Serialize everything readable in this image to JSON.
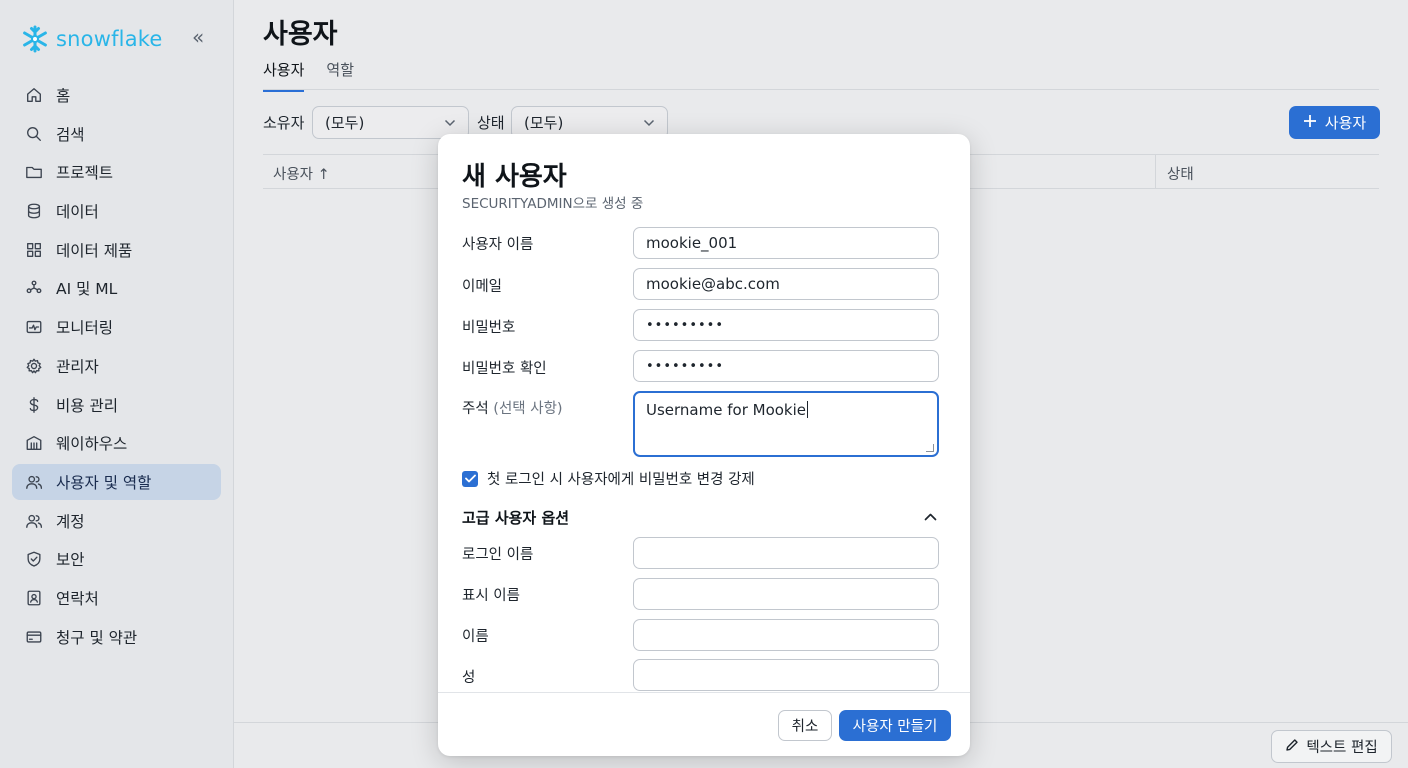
{
  "brand": {
    "name": "snowflake",
    "collapse_icon": "«"
  },
  "sidebar": {
    "items": [
      {
        "label": "홈",
        "icon": "home-icon"
      },
      {
        "label": "검색",
        "icon": "search-icon"
      },
      {
        "label": "프로젝트",
        "icon": "folder-icon"
      },
      {
        "label": "데이터",
        "icon": "database-icon"
      },
      {
        "label": "데이터 제품",
        "icon": "grid-icon"
      },
      {
        "label": "AI 및 ML",
        "icon": "ai-icon"
      },
      {
        "label": "모니터링",
        "icon": "monitor-icon"
      },
      {
        "label": "관리자",
        "icon": "gear-icon"
      },
      {
        "label": "비용 관리",
        "icon": "dollar-icon"
      },
      {
        "label": "웨이하우스",
        "icon": "warehouse-icon"
      },
      {
        "label": "사용자 및 역할",
        "icon": "users-icon",
        "active": true
      },
      {
        "label": "계정",
        "icon": "account-icon"
      },
      {
        "label": "보안",
        "icon": "shield-icon"
      },
      {
        "label": "연락처",
        "icon": "contact-icon"
      },
      {
        "label": "청구 및 약관",
        "icon": "card-icon"
      }
    ]
  },
  "main": {
    "title": "사용자",
    "tabs": [
      {
        "label": "사용자",
        "active": true
      },
      {
        "label": "역할"
      }
    ],
    "filters": {
      "owner_label": "소유자",
      "owner_value": "(모두)",
      "status_label": "상태",
      "status_value": "(모두)"
    },
    "add_button_label": "사용자",
    "table": {
      "col_user": "사용자 ↑",
      "col_status": "상태"
    },
    "edit_text_button": "텍스트 편집"
  },
  "modal": {
    "title": "새 사용자",
    "subtitle": "SECURITYADMIN으로 생성 중",
    "fields": {
      "username_label": "사용자 이름",
      "username_value": "mookie_001",
      "email_label": "이메일",
      "email_value": "mookie@abc.com",
      "password_label": "비밀번호",
      "password_value": "•••••••••",
      "confirm_label": "비밀번호 확인",
      "confirm_value": "•••••••••",
      "comment_label": "주석",
      "comment_optional": "(선택 사항)",
      "comment_value": "Username for Mookie"
    },
    "force_password_change": {
      "label": "첫 로그인 시 사용자에게 비밀번호 변경 강제",
      "checked": true
    },
    "advanced": {
      "heading": "고급 사용자 옵션",
      "expanded": true,
      "login_name_label": "로그인 이름",
      "display_name_label": "표시 이름",
      "first_name_label": "이름",
      "last_name_label": "성"
    },
    "cancel_label": "취소",
    "create_label": "사용자 만들기"
  },
  "colors": {
    "accent": "#2b6fd3",
    "brand": "#29b5e8",
    "active_nav": "#c6d4e6"
  }
}
